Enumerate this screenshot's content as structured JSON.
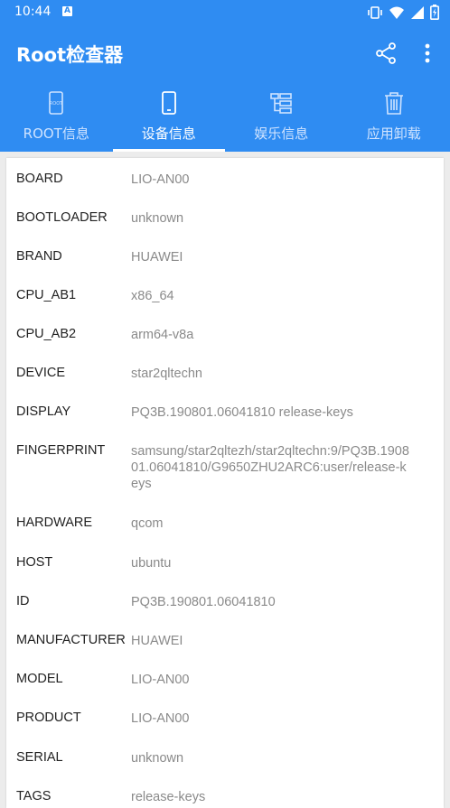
{
  "status_bar": {
    "time": "10:44",
    "badge": "A"
  },
  "app": {
    "title": "Root检查器"
  },
  "tabs": [
    {
      "label": "ROOT信息",
      "icon": "root-phone-icon",
      "active": false
    },
    {
      "label": "设备信息",
      "icon": "phone-icon",
      "active": true
    },
    {
      "label": "娱乐信息",
      "icon": "list-icon",
      "active": false
    },
    {
      "label": "应用卸载",
      "icon": "trash-icon",
      "active": false
    }
  ],
  "device_info": [
    {
      "key": "BOARD",
      "value": "LIO-AN00"
    },
    {
      "key": "BOOTLOADER",
      "value": "unknown"
    },
    {
      "key": "BRAND",
      "value": "HUAWEI"
    },
    {
      "key": "CPU_AB1",
      "value": "x86_64"
    },
    {
      "key": "CPU_AB2",
      "value": "arm64-v8a"
    },
    {
      "key": "DEVICE",
      "value": "star2qltechn"
    },
    {
      "key": "DISPLAY",
      "value": "PQ3B.190801.06041810 release-keys"
    },
    {
      "key": "FINGERPRINT",
      "value": "samsung/star2qltezh/star2qltechn:9/PQ3B.190801.06041810/G9650ZHU2ARC6:user/release-keys"
    },
    {
      "key": "HARDWARE",
      "value": "qcom"
    },
    {
      "key": "HOST",
      "value": "ubuntu"
    },
    {
      "key": "ID",
      "value": "PQ3B.190801.06041810"
    },
    {
      "key": "MANUFACTURER",
      "value": "HUAWEI"
    },
    {
      "key": "MODEL",
      "value": "LIO-AN00"
    },
    {
      "key": "PRODUCT",
      "value": "LIO-AN00"
    },
    {
      "key": "SERIAL",
      "value": "unknown"
    },
    {
      "key": "TAGS",
      "value": "release-keys"
    }
  ]
}
